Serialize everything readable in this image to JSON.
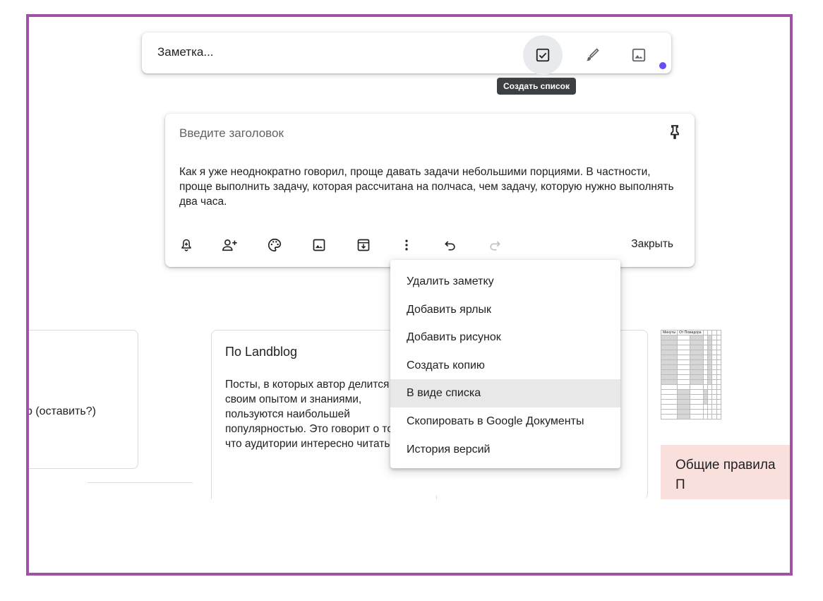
{
  "take_note": {
    "placeholder": "Заметка...",
    "tooltip": "Создать список",
    "icons": [
      "checkbox-icon",
      "brush-icon",
      "image-icon"
    ]
  },
  "editor": {
    "title_placeholder": "Введите заголовок",
    "body": "Как я уже неоднократно говорил, проще давать задачи небольшими порциями. В частности, проще выполнить задачу, которая рассчитана на полчаса, чем задачу, которую нужно выполнять два часа.",
    "toolbar_icons": [
      "reminder-icon",
      "collaborator-icon",
      "palette-icon",
      "image-icon",
      "archive-icon",
      "more-vert-icon",
      "undo-icon",
      "redo-icon"
    ],
    "close_label": "Закрыть"
  },
  "menu": {
    "items": [
      "Удалить заметку",
      "Добавить ярлык",
      "Добавить рисунок",
      "Создать копию",
      "В виде списка",
      "Скопировать в Google Документы",
      "История версий"
    ],
    "highlighted_index": 4
  },
  "notes": {
    "left": {
      "title_fragment": ")",
      "text_fragment": "р (оставить?)"
    },
    "landblog": {
      "title": "По Landblog",
      "body": "Посты, в которых автор делится своим опытом и знаниями, пользуются наибольшей популярностью. Это говорит о том, что аудитории интересно читать о"
    },
    "sheet": {
      "header": [
        "Минуты",
        "От Помидора"
      ],
      "pink_title": "Общие правила",
      "pink_sub": "П"
    }
  },
  "colors": {
    "frame": "#a052a8",
    "accent_dot": "#6a4cf5",
    "pink_note": "#fae0dc",
    "menu_highlight": "#e8e8e8"
  }
}
